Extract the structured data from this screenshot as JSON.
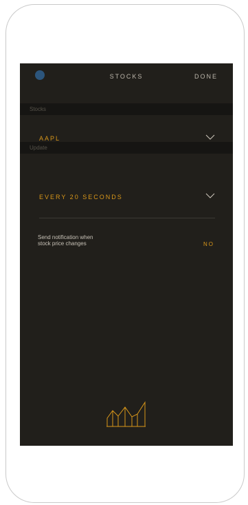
{
  "header": {
    "title": "STOCKS",
    "done_label": "DONE"
  },
  "sections": {
    "stocks_header": "Stocks",
    "update_header": "Update"
  },
  "stock_select": {
    "value": "AAPL"
  },
  "update_select": {
    "value": "EVERY 20 SECONDS"
  },
  "notification": {
    "label_line1": "Send notification when",
    "label_line2": "stock price changes",
    "value": "NO"
  },
  "colors": {
    "accent": "#d9971a",
    "background": "#211f1b",
    "section_bg": "#161513"
  },
  "icons": {
    "chevron": "chevron-down-icon",
    "logo": "stock-chart-logo-icon"
  }
}
